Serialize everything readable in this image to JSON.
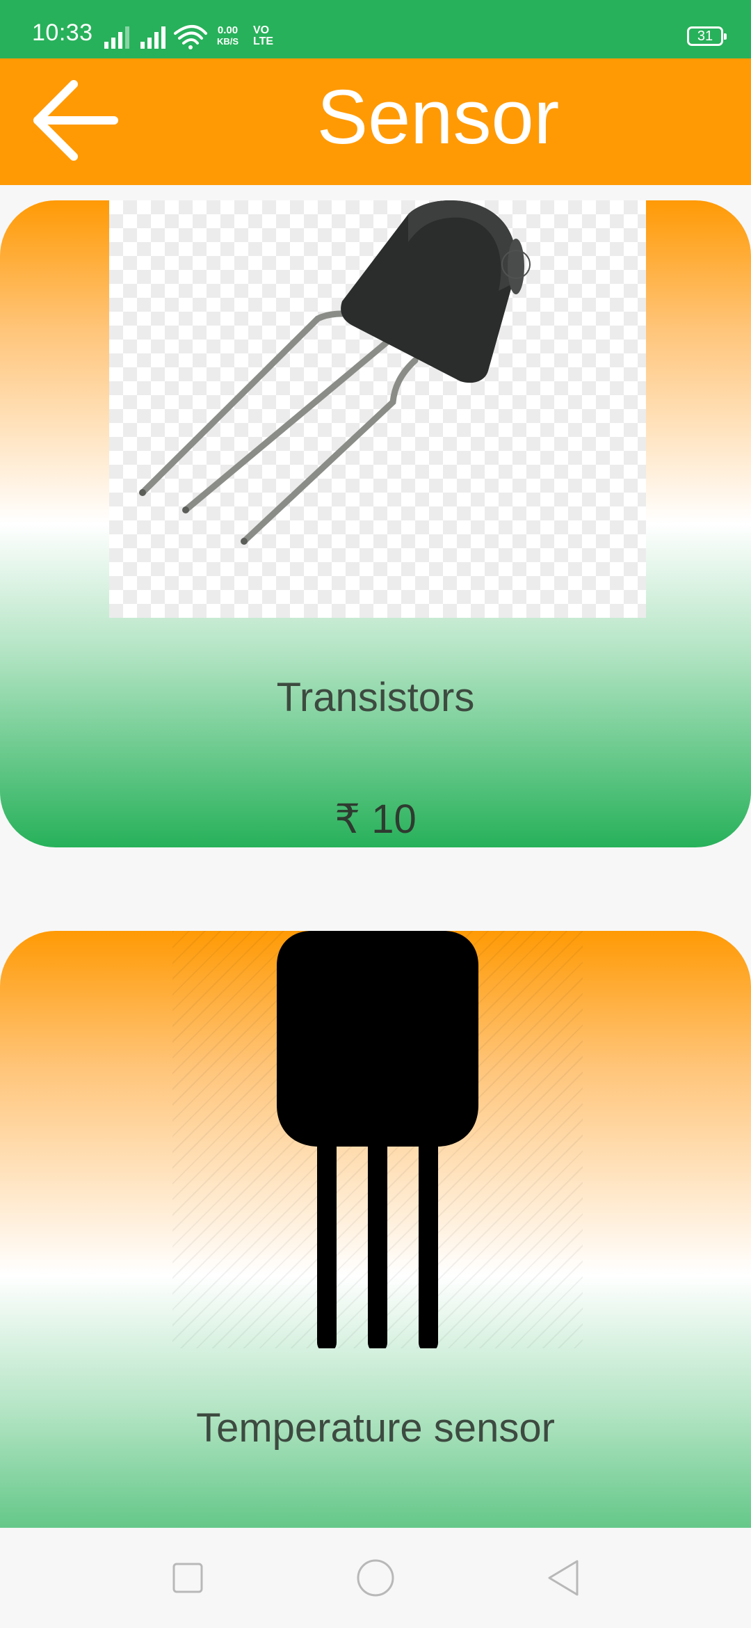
{
  "status_bar": {
    "time": "10:33",
    "network_speed_value": "0.00",
    "network_speed_unit": "KB/S",
    "volte_top": "VO",
    "volte_bottom": "LTE",
    "battery_level": "31"
  },
  "app_bar": {
    "title": "Sensor",
    "back_icon": "arrow-left-icon"
  },
  "products": [
    {
      "name": "Transistors",
      "price": "₹ 10",
      "image": "transistor-photo"
    },
    {
      "name": "Temperature sensor",
      "image": "temperature-sensor-icon"
    }
  ],
  "nav_bar": {
    "recent_icon": "square-icon",
    "home_icon": "circle-icon",
    "back_icon": "triangle-back-icon"
  },
  "colors": {
    "status_bar": "#27b15a",
    "app_bar": "#ff9a05",
    "card_top": "#ff9a05",
    "card_bottom": "#27b15a"
  }
}
